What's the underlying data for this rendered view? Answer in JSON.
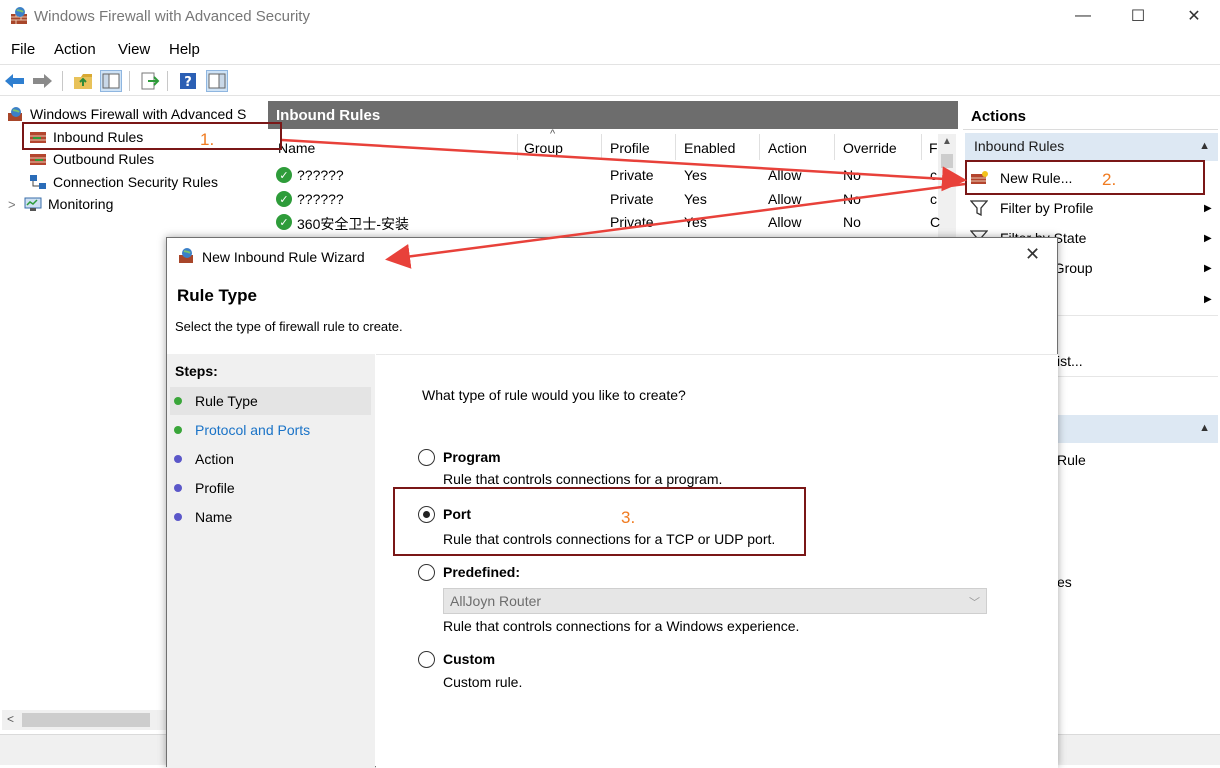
{
  "window": {
    "title": "Windows Firewall with Advanced Security",
    "controls": {
      "minimize": "—",
      "maximize": "☐",
      "close": "✕"
    }
  },
  "menu": [
    "File",
    "Action",
    "View",
    "Help"
  ],
  "tree": {
    "root": "Windows Firewall with Advanced S",
    "items": [
      "Inbound Rules",
      "Outbound Rules",
      "Connection Security Rules",
      "Monitoring"
    ],
    "expander": ">"
  },
  "center": {
    "header": "Inbound Rules",
    "columns": [
      "Name",
      "Group",
      "Profile",
      "Enabled",
      "Action",
      "Override",
      "F"
    ],
    "rows": [
      {
        "name": "??????",
        "profile": "Private",
        "enabled": "Yes",
        "action": "Allow",
        "override": "No",
        "extra": "c"
      },
      {
        "name": "??????",
        "profile": "Private",
        "enabled": "Yes",
        "action": "Allow",
        "override": "No",
        "extra": "c"
      },
      {
        "name": "360安全卫士-安装",
        "profile": "Private",
        "enabled": "Yes",
        "action": "Allow",
        "override": "No",
        "extra": "C"
      }
    ]
  },
  "actions": {
    "title": "Actions",
    "section1": "Inbound Rules",
    "items": [
      "New Rule...",
      "Filter by Profile",
      "Filter by State",
      "Filter by Group"
    ],
    "visible_fragments": [
      "Group",
      "ist...",
      "Rule",
      "es"
    ],
    "partial_state": "State"
  },
  "dialog": {
    "title": "New Inbound Rule Wizard",
    "heading": "Rule Type",
    "subheading": "Select the type of firewall rule to create.",
    "steps_title": "Steps:",
    "steps": [
      {
        "label": "Rule Type",
        "color": "#3aa63a",
        "text_color": "#000000"
      },
      {
        "label": "Protocol and Ports",
        "color": "#3aa63a",
        "text_color": "#1a73c7"
      },
      {
        "label": "Action",
        "color": "#5b57c9",
        "text_color": "#000000"
      },
      {
        "label": "Profile",
        "color": "#5b57c9",
        "text_color": "#000000"
      },
      {
        "label": "Name",
        "color": "#5b57c9",
        "text_color": "#000000"
      }
    ],
    "question": "What type of rule would you like to create?",
    "options": [
      {
        "label": "Program",
        "desc": "Rule that controls connections for a program.",
        "checked": false
      },
      {
        "label": "Port",
        "desc": "Rule that controls connections for a TCP or UDP port.",
        "checked": true
      },
      {
        "label": "Predefined:",
        "desc": "Rule that controls connections for a Windows experience.",
        "checked": false
      },
      {
        "label": "Custom",
        "desc": "Custom rule.",
        "checked": false
      }
    ],
    "predefined_value": "AllJoyn Router"
  },
  "annotations": [
    "1.",
    "2.",
    "3."
  ],
  "colors": {
    "annotation_box": "#7a1717",
    "annotation_number": "#f07b20",
    "arrow": "#e8413a",
    "header_bg": "#6d6d6d",
    "action_section_bg": "#dde8f3"
  }
}
